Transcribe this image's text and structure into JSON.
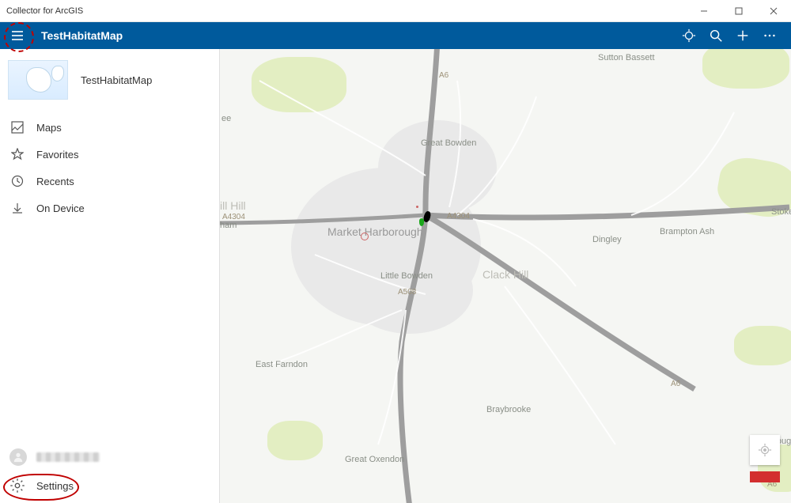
{
  "window": {
    "title": "Collector for ArcGIS"
  },
  "appbar": {
    "title": "TestHabitatMap"
  },
  "sidebar": {
    "map_title": "TestHabitatMap",
    "nav": {
      "maps": "Maps",
      "favorites": "Favorites",
      "recents": "Recents",
      "on_device": "On Device"
    },
    "settings_label": "Settings"
  },
  "map": {
    "places": {
      "sutton_bassett": "Sutton Bassett",
      "great_bowden": "Great Bowden",
      "market_harborough": "Market Harborough",
      "little_bowden": "Little Bowden",
      "clack_hill": "Clack Hill",
      "dingley": "Dingley",
      "brampton_ash": "Brampton Ash",
      "stoke": "Stoke",
      "ill_hill": "ill Hill",
      "ee": "ee",
      "ham": "ham",
      "east_farndon": "East Farndon",
      "great_oxendon": "Great Oxendon",
      "braybrooke": "Braybrooke",
      "borough": "borough"
    },
    "roads": {
      "a6_n": "A6",
      "a6_e": "A6",
      "a6_se": "A6",
      "a4304_e": "A4304",
      "a4304_w": "A4304",
      "a508": "A508"
    }
  }
}
